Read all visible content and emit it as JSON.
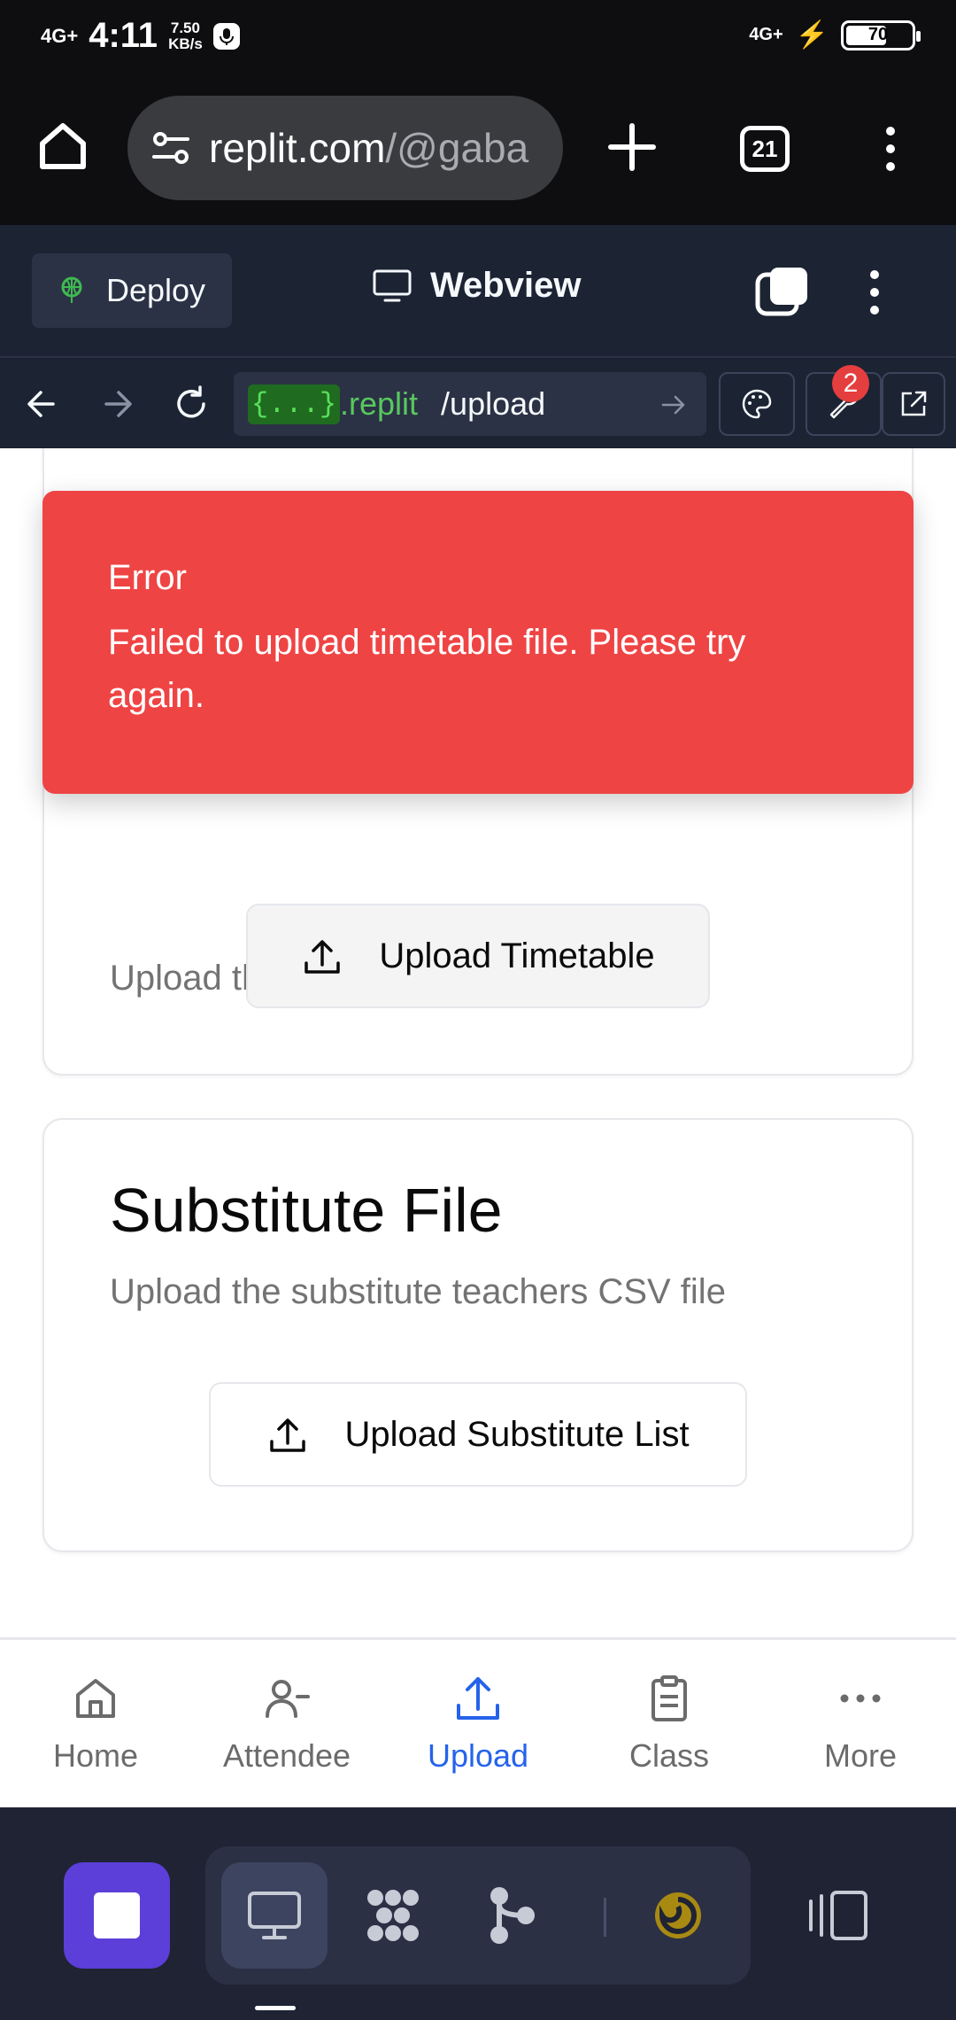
{
  "status_bar": {
    "signal": "4G+",
    "time": "4:11",
    "speed": "7.50",
    "speed_unit": "KB/s",
    "network_right": "4G+",
    "battery": "70"
  },
  "browser": {
    "url_host": "replit.com",
    "url_path": "/@gaba",
    "tabs_count": "21"
  },
  "replit": {
    "deploy_label": "Deploy",
    "webview_label": "Webview",
    "address_tag": "{...}",
    "address_host": ".replit",
    "address_path": "/upload",
    "devtools_badge": "2"
  },
  "toast": {
    "title": "Error",
    "message": "Failed to upload timetable file. Please try again."
  },
  "timetable_card": {
    "subtitle": "Upload the school timetable CSV file",
    "button": "Upload Timetable"
  },
  "substitute_card": {
    "title": "Substitute File",
    "subtitle": "Upload the substitute teachers CSV file",
    "button": "Upload Substitute List"
  },
  "app_nav": {
    "items": [
      {
        "label": "Home",
        "icon": "home-icon"
      },
      {
        "label": "Attendee",
        "icon": "user-minus-icon"
      },
      {
        "label": "Upload",
        "icon": "upload-icon",
        "active": true
      },
      {
        "label": "Class",
        "icon": "clipboard-icon"
      },
      {
        "label": "More",
        "icon": "more-horizontal-icon"
      }
    ],
    "active_color": "#2563eb"
  },
  "colors": {
    "error": "#ef4444",
    "replit_bg": "#1c2333",
    "stop_button": "#5b3fd8"
  }
}
